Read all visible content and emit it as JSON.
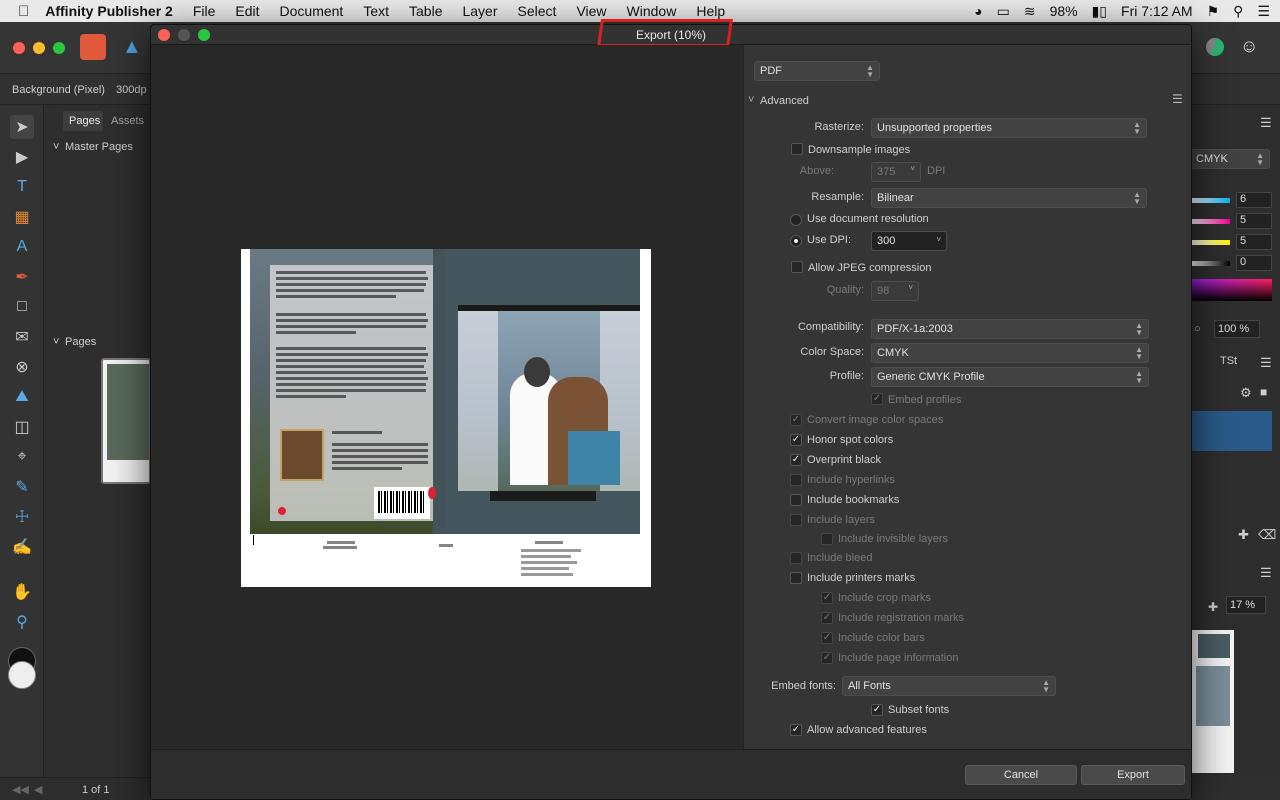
{
  "menubar": {
    "app_name": "Affinity Publisher 2",
    "items": [
      "File",
      "Edit",
      "Document",
      "Text",
      "Table",
      "Layer",
      "Select",
      "View",
      "Window",
      "Help"
    ],
    "battery": "98%",
    "clock": "Fri 7:12 AM"
  },
  "context_bar": {
    "layer": "Background (Pixel)",
    "dpi": "300dp"
  },
  "left_panel": {
    "tabs": [
      "Pages",
      "Assets"
    ],
    "master_pages": "Master Pages",
    "pages": "Pages"
  },
  "status": {
    "page_count": "1 of 1"
  },
  "right_panel": {
    "color_mode": "CMYK",
    "c": "6",
    "m": "5",
    "y": "5",
    "k": "0",
    "opacity": "100 %",
    "tab": "TSt",
    "zoom": "17 %"
  },
  "dialog": {
    "title": "Export (10%)",
    "format": "PDF",
    "section": "Advanced",
    "rasterize_label": "Rasterize:",
    "rasterize_value": "Unsupported properties",
    "downsample_label": "Downsample images",
    "above_label": "Above:",
    "above_value": "375",
    "dpi_unit": "DPI",
    "resample_label": "Resample:",
    "resample_value": "Bilinear",
    "use_doc_res": "Use document resolution",
    "use_dpi_label": "Use DPI:",
    "use_dpi_value": "300",
    "jpeg_label": "Allow JPEG compression",
    "quality_label": "Quality:",
    "quality_value": "98",
    "compat_label": "Compatibility:",
    "compat_value": "PDF/X-1a:2003",
    "colorspace_label": "Color Space:",
    "colorspace_value": "CMYK",
    "profile_label": "Profile:",
    "profile_value": "Generic CMYK Profile",
    "embed_profiles": "Embed profiles",
    "convert_colors": "Convert image color spaces",
    "honor_spot": "Honor spot colors",
    "overprint": "Overprint black",
    "hyperlinks": "Include hyperlinks",
    "bookmarks": "Include bookmarks",
    "layers": "Include layers",
    "invisible_layers": "Include invisible layers",
    "bleed": "Include bleed",
    "printer_marks": "Include printers marks",
    "crop_marks": "Include crop marks",
    "registration": "Include registration marks",
    "color_bars": "Include color bars",
    "page_info": "Include page information",
    "embed_fonts_label": "Embed  fonts:",
    "embed_fonts_value": "All Fonts",
    "subset_fonts": "Subset fonts",
    "advanced_features": "Allow advanced features",
    "cancel": "Cancel",
    "export": "Export"
  }
}
